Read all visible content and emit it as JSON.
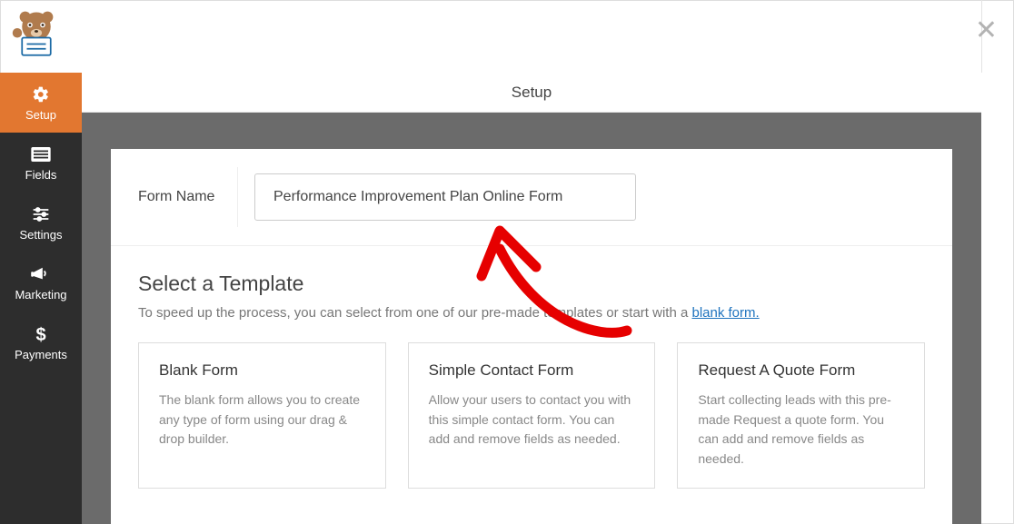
{
  "sidebar": {
    "items": [
      {
        "label": "Setup"
      },
      {
        "label": "Fields"
      },
      {
        "label": "Settings"
      },
      {
        "label": "Marketing"
      },
      {
        "label": "Payments"
      }
    ]
  },
  "topbar": {
    "title": "Setup"
  },
  "form_name": {
    "label": "Form Name",
    "value": "Performance Improvement Plan Online Form"
  },
  "select_template": {
    "heading": "Select a Template",
    "description_prefix": "To speed up the process, you can select from one of our pre-made templates or start with a ",
    "blank_link_text": "blank form."
  },
  "templates": [
    {
      "title": "Blank Form",
      "desc": "The blank form allows you to create any type of form using our drag & drop builder."
    },
    {
      "title": "Simple Contact Form",
      "desc": "Allow your users to contact you with this simple contact form. You can add and remove fields as needed."
    },
    {
      "title": "Request A Quote Form",
      "desc": "Start collecting leads with this pre-made Request a quote form. You can add and remove fields as needed."
    }
  ]
}
